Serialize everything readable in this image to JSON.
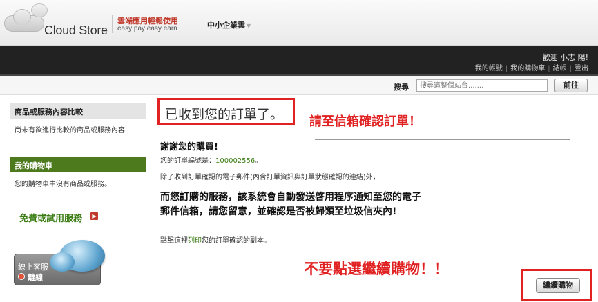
{
  "header": {
    "brand": "Cloud Store",
    "tagline_zh": "雲端應用輕鬆使用",
    "tagline_en": "easy pay easy earn",
    "sme_menu": "中小企業雲"
  },
  "topbar": {
    "welcome": "歡迎 小志 陽!",
    "links": [
      "我的帳號",
      "我的購物車",
      "結帳",
      "登出"
    ]
  },
  "search": {
    "label": "搜尋",
    "placeholder": "搜尋這整個站台.......",
    "button": "前往"
  },
  "sidebar": {
    "compare_title": "商品或服務內容比較",
    "compare_body": "尚未有欲進行比較的商品或服務內容",
    "cart_title": "我的購物車",
    "cart_body": "您的購物車中沒有商品或服務。",
    "free_link": "免費或試用服務",
    "support_title": "線上客服",
    "support_status": "離線"
  },
  "main": {
    "title": "已收到您的訂單了。",
    "annotation_top": "請至信箱確認訂單！",
    "thanks": "謝謝您的購買!",
    "order_prefix": "您的訂單編號是：",
    "order_number": "100002556",
    "order_suffix": "。",
    "email_line": "除了收到訂單確認的電子郵件(內含訂單資訊與訂單狀態確認的連結)外，",
    "notice_line1": "而您訂購的服務，該系統會自動發送啓用程序通知至您的電子",
    "notice_line2": "郵件信箱，請您留意，並確認是否被歸類至垃圾信夾內!",
    "print_prefix": "點擊這裡",
    "print_link": "列印",
    "print_suffix": "您的訂單確認的副本。",
    "annotation_bottom": "不要點選繼續購物！！",
    "continue_button": "繼續購物"
  },
  "colors": {
    "annotation_red": "#e12222",
    "link_green": "#3b7d14",
    "topbar_bg": "#222222",
    "sidebar_green": "#4e7a1e"
  }
}
